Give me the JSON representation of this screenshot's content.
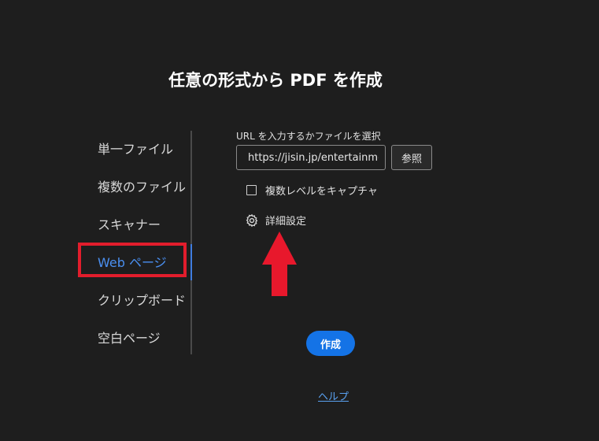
{
  "dialog": {
    "title": "任意の形式から PDF を作成"
  },
  "nav": {
    "items": [
      {
        "label": "単一ファイル"
      },
      {
        "label": "複数のファイル"
      },
      {
        "label": "スキャナー"
      },
      {
        "label": "Web ページ",
        "active": true
      },
      {
        "label": "クリップボード"
      },
      {
        "label": "空白ページ"
      }
    ]
  },
  "web": {
    "url_label": "URL を入力するかファイルを選択",
    "url_value": "https://jisin.jp/entertainme",
    "browse_label": "参照",
    "capture_levels_label": "複数レベルをキャプチャ",
    "capture_levels_checked": false,
    "advanced_settings_label": "詳細設定"
  },
  "actions": {
    "create_label": "作成",
    "help_label": "ヘルプ"
  },
  "colors": {
    "background": "#1e1e1e",
    "accent": "#1473e6",
    "active_nav": "#4a8ff0",
    "highlight": "#e21d2c",
    "link": "#5aa2f2"
  },
  "icons": {
    "settings": "gear-icon",
    "annotation": "red-arrow-up-icon"
  }
}
